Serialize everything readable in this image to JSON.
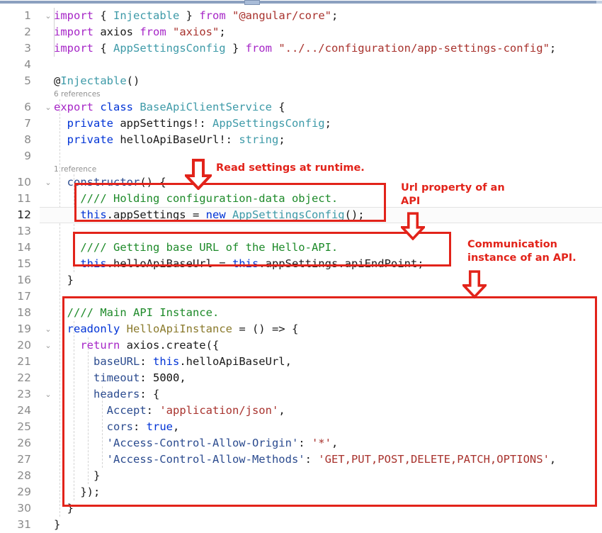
{
  "window": {
    "kind": "code-editor",
    "language": "typescript",
    "colors": {
      "keyword": "#a626c7",
      "keyword_blue": "#0033d6",
      "type": "#3e9aa8",
      "string": "#a8322d",
      "comment": "#1d8a29",
      "annotation_red": "#e2231a",
      "gutter_text": "#8a8a8a",
      "codelens": "#919191",
      "background": "#ffffff",
      "scrollbar": "#8ba0bf"
    }
  },
  "scrollbar": {
    "name": "horizontal-scrollbar",
    "thumb_left_pct": 41
  },
  "gutter": {
    "line_numbers": [
      "1",
      "2",
      "3",
      "4",
      "5",
      "6",
      "7",
      "8",
      "9",
      "10",
      "11",
      "12",
      "13",
      "14",
      "15",
      "16",
      "17",
      "18",
      "19",
      "20",
      "21",
      "22",
      "23",
      "24",
      "25",
      "26",
      "27",
      "28",
      "29",
      "30",
      "31"
    ],
    "active_line": "12",
    "fold_chevron": "⌄"
  },
  "codelens": [
    {
      "line": 5,
      "text": "6 references"
    },
    {
      "line": 9,
      "text": "1 reference"
    }
  ],
  "code": {
    "lines": [
      {
        "n": "1",
        "fold": true,
        "tokens": [
          {
            "t": "import ",
            "c": "kw"
          },
          {
            "t": "{ ",
            "c": "plain"
          },
          {
            "t": "Injectable",
            "c": "type"
          },
          {
            "t": " } ",
            "c": "plain"
          },
          {
            "t": "from ",
            "c": "kw"
          },
          {
            "t": "\"@angular/core\"",
            "c": "str"
          },
          {
            "t": ";",
            "c": "plain"
          }
        ]
      },
      {
        "n": "2",
        "fold": false,
        "tokens": [
          {
            "t": "import ",
            "c": "kw"
          },
          {
            "t": "axios ",
            "c": "plain"
          },
          {
            "t": "from ",
            "c": "kw"
          },
          {
            "t": "\"axios\"",
            "c": "str"
          },
          {
            "t": ";",
            "c": "plain"
          }
        ]
      },
      {
        "n": "3",
        "fold": false,
        "tokens": [
          {
            "t": "import ",
            "c": "kw"
          },
          {
            "t": "{ ",
            "c": "plain"
          },
          {
            "t": "AppSettingsConfig",
            "c": "type"
          },
          {
            "t": " } ",
            "c": "plain"
          },
          {
            "t": "from ",
            "c": "kw"
          },
          {
            "t": "\"../../configuration/app-settings-config\"",
            "c": "str"
          },
          {
            "t": ";",
            "c": "plain"
          }
        ]
      },
      {
        "n": "4",
        "fold": false,
        "tokens": []
      },
      {
        "n": "5",
        "fold": false,
        "tokens": [
          {
            "t": "@",
            "c": "plain"
          },
          {
            "t": "Injectable",
            "c": "deco"
          },
          {
            "t": "()",
            "c": "plain"
          }
        ]
      },
      {
        "n": "6",
        "fold": true,
        "tokens": [
          {
            "t": "export ",
            "c": "kw"
          },
          {
            "t": "class ",
            "c": "kw2"
          },
          {
            "t": "BaseApiClientService",
            "c": "type"
          },
          {
            "t": " {",
            "c": "plain"
          }
        ]
      },
      {
        "n": "7",
        "fold": false,
        "tokens": [
          {
            "t": "  ",
            "c": "plain"
          },
          {
            "t": "private ",
            "c": "kw2"
          },
          {
            "t": "appSettings",
            "c": "plain"
          },
          {
            "t": "!: ",
            "c": "plain"
          },
          {
            "t": "AppSettingsConfig",
            "c": "type"
          },
          {
            "t": ";",
            "c": "plain"
          }
        ]
      },
      {
        "n": "8",
        "fold": false,
        "tokens": [
          {
            "t": "  ",
            "c": "plain"
          },
          {
            "t": "private ",
            "c": "kw2"
          },
          {
            "t": "helloApiBaseUrl",
            "c": "plain"
          },
          {
            "t": "!: ",
            "c": "plain"
          },
          {
            "t": "string",
            "c": "type"
          },
          {
            "t": ";",
            "c": "plain"
          }
        ]
      },
      {
        "n": "9",
        "fold": false,
        "tokens": []
      },
      {
        "n": "10",
        "fold": true,
        "tokens": [
          {
            "t": "  ",
            "c": "plain"
          },
          {
            "t": "constructor",
            "c": "prop"
          },
          {
            "t": "() {",
            "c": "plain"
          }
        ]
      },
      {
        "n": "11",
        "fold": false,
        "tokens": [
          {
            "t": "    ",
            "c": "plain"
          },
          {
            "t": "//// Holding configuration-data object.",
            "c": "cmt"
          }
        ]
      },
      {
        "n": "12",
        "fold": false,
        "tokens": [
          {
            "t": "    ",
            "c": "plain"
          },
          {
            "t": "this",
            "c": "this"
          },
          {
            "t": ".appSettings ",
            "c": "plain"
          },
          {
            "t": "= ",
            "c": "plain"
          },
          {
            "t": "new ",
            "c": "kw2"
          },
          {
            "t": "AppSettingsConfig",
            "c": "type"
          },
          {
            "t": "();",
            "c": "plain"
          }
        ]
      },
      {
        "n": "13",
        "fold": false,
        "tokens": []
      },
      {
        "n": "14",
        "fold": false,
        "tokens": [
          {
            "t": "    ",
            "c": "plain"
          },
          {
            "t": "//// Getting base URL of the Hello-API.",
            "c": "cmt"
          }
        ]
      },
      {
        "n": "15",
        "fold": false,
        "tokens": [
          {
            "t": "    ",
            "c": "plain"
          },
          {
            "t": "this",
            "c": "this"
          },
          {
            "t": ".helloApiBaseUrl = ",
            "c": "plain"
          },
          {
            "t": "this",
            "c": "this"
          },
          {
            "t": ".appSettings.apiEndPoint;",
            "c": "plain"
          }
        ]
      },
      {
        "n": "16",
        "fold": false,
        "tokens": [
          {
            "t": "  }",
            "c": "plain"
          }
        ]
      },
      {
        "n": "17",
        "fold": false,
        "tokens": []
      },
      {
        "n": "18",
        "fold": false,
        "tokens": [
          {
            "t": "  ",
            "c": "plain"
          },
          {
            "t": "//// Main API Instance.",
            "c": "cmt"
          }
        ]
      },
      {
        "n": "19",
        "fold": true,
        "tokens": [
          {
            "t": "  ",
            "c": "plain"
          },
          {
            "t": "readonly ",
            "c": "ro"
          },
          {
            "t": "HelloApiInstance ",
            "c": "fn"
          },
          {
            "t": "= () => {",
            "c": "plain"
          }
        ]
      },
      {
        "n": "20",
        "fold": true,
        "tokens": [
          {
            "t": "    ",
            "c": "plain"
          },
          {
            "t": "return ",
            "c": "kw"
          },
          {
            "t": "axios.create({",
            "c": "plain"
          }
        ]
      },
      {
        "n": "21",
        "fold": false,
        "tokens": [
          {
            "t": "      ",
            "c": "plain"
          },
          {
            "t": "baseURL",
            "c": "prop"
          },
          {
            "t": ": ",
            "c": "plain"
          },
          {
            "t": "this",
            "c": "this"
          },
          {
            "t": ".helloApiBaseUrl,",
            "c": "plain"
          }
        ]
      },
      {
        "n": "22",
        "fold": false,
        "tokens": [
          {
            "t": "      ",
            "c": "plain"
          },
          {
            "t": "timeout",
            "c": "prop"
          },
          {
            "t": ": ",
            "c": "plain"
          },
          {
            "t": "5000",
            "c": "num"
          },
          {
            "t": ",",
            "c": "plain"
          }
        ]
      },
      {
        "n": "23",
        "fold": true,
        "tokens": [
          {
            "t": "      ",
            "c": "plain"
          },
          {
            "t": "headers",
            "c": "prop"
          },
          {
            "t": ": {",
            "c": "plain"
          }
        ]
      },
      {
        "n": "24",
        "fold": false,
        "tokens": [
          {
            "t": "        ",
            "c": "plain"
          },
          {
            "t": "Accept",
            "c": "prop"
          },
          {
            "t": ": ",
            "c": "plain"
          },
          {
            "t": "'application/json'",
            "c": "str"
          },
          {
            "t": ",",
            "c": "plain"
          }
        ]
      },
      {
        "n": "25",
        "fold": false,
        "tokens": [
          {
            "t": "        ",
            "c": "plain"
          },
          {
            "t": "cors",
            "c": "prop"
          },
          {
            "t": ": ",
            "c": "plain"
          },
          {
            "t": "true",
            "c": "kw2"
          },
          {
            "t": ",",
            "c": "plain"
          }
        ]
      },
      {
        "n": "26",
        "fold": false,
        "tokens": [
          {
            "t": "        ",
            "c": "plain"
          },
          {
            "t": "'Access-Control-Allow-Origin'",
            "c": "prop"
          },
          {
            "t": ": ",
            "c": "plain"
          },
          {
            "t": "'*'",
            "c": "str"
          },
          {
            "t": ",",
            "c": "plain"
          }
        ]
      },
      {
        "n": "27",
        "fold": false,
        "tokens": [
          {
            "t": "        ",
            "c": "plain"
          },
          {
            "t": "'Access-Control-Allow-Methods'",
            "c": "prop"
          },
          {
            "t": ": ",
            "c": "plain"
          },
          {
            "t": "'GET,PUT,POST,DELETE,PATCH,OPTIONS'",
            "c": "str"
          },
          {
            "t": ",",
            "c": "plain"
          }
        ]
      },
      {
        "n": "28",
        "fold": false,
        "tokens": [
          {
            "t": "      }",
            "c": "plain"
          }
        ]
      },
      {
        "n": "29",
        "fold": false,
        "tokens": [
          {
            "t": "    });",
            "c": "plain"
          }
        ]
      },
      {
        "n": "30",
        "fold": false,
        "tokens": [
          {
            "t": "  }",
            "c": "plain"
          }
        ]
      },
      {
        "n": "31",
        "fold": false,
        "tokens": [
          {
            "t": "}",
            "c": "plain"
          }
        ]
      }
    ]
  },
  "annotations": {
    "notes": [
      {
        "id": "note-read-settings",
        "text": "Read settings at runtime."
      },
      {
        "id": "note-url-property",
        "text": "Url property of an\nAPI"
      },
      {
        "id": "note-communication",
        "text": "Communication\ninstance of an API."
      }
    ],
    "boxes": [
      {
        "id": "box-constructor-appsettings",
        "lines": "11-12"
      },
      {
        "id": "box-base-url",
        "lines": "14-15"
      },
      {
        "id": "box-api-instance",
        "lines": "18-30"
      }
    ],
    "arrows": [
      {
        "id": "arrow-read-settings",
        "direction": "down"
      },
      {
        "id": "arrow-url-property",
        "direction": "down"
      },
      {
        "id": "arrow-communication",
        "direction": "down"
      }
    ]
  }
}
